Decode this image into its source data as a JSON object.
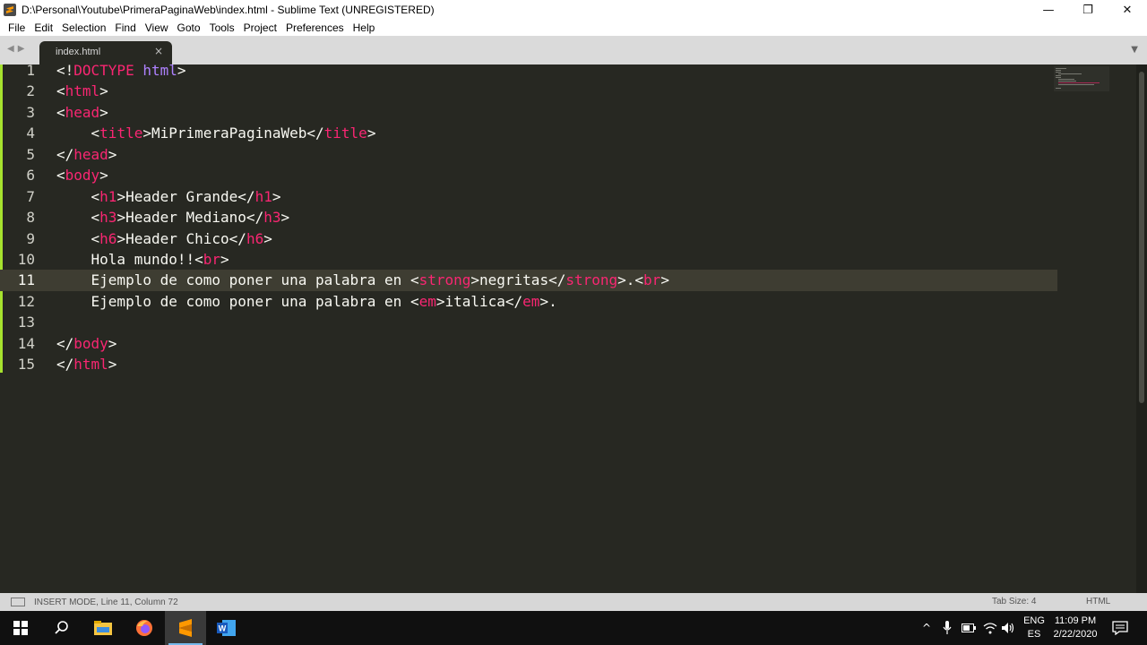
{
  "window": {
    "title": "D:\\Personal\\Youtube\\PrimeraPaginaWeb\\index.html - Sublime Text (UNREGISTERED)",
    "minimize_glyph": "—",
    "maximize_glyph": "❐",
    "close_glyph": "✕"
  },
  "menu": [
    {
      "label": "File"
    },
    {
      "label": "Edit"
    },
    {
      "label": "Selection"
    },
    {
      "label": "Find"
    },
    {
      "label": "View"
    },
    {
      "label": "Goto"
    },
    {
      "label": "Tools"
    },
    {
      "label": "Project"
    },
    {
      "label": "Preferences"
    },
    {
      "label": "Help"
    }
  ],
  "tabs": {
    "nav_glyph": "◀▶",
    "active_tab": {
      "label": "index.html",
      "close_glyph": "×"
    },
    "dropdown_glyph": "▼"
  },
  "editor": {
    "active_line": 11,
    "lines": [
      [
        {
          "c": "p",
          "v": "<!"
        },
        {
          "c": "t",
          "v": "DOCTYPE"
        },
        {
          "c": "p",
          "v": " "
        },
        {
          "c": "kw",
          "v": "html"
        },
        {
          "c": "p",
          "v": ">"
        }
      ],
      [
        {
          "c": "p",
          "v": "<"
        },
        {
          "c": "t",
          "v": "html"
        },
        {
          "c": "p",
          "v": ">"
        }
      ],
      [
        {
          "c": "p",
          "v": "<"
        },
        {
          "c": "t",
          "v": "head"
        },
        {
          "c": "p",
          "v": ">"
        }
      ],
      [
        {
          "c": "p",
          "v": "    <"
        },
        {
          "c": "t",
          "v": "title"
        },
        {
          "c": "p",
          "v": ">MiPrimeraPaginaWeb</"
        },
        {
          "c": "t",
          "v": "title"
        },
        {
          "c": "p",
          "v": ">"
        }
      ],
      [
        {
          "c": "p",
          "v": "</"
        },
        {
          "c": "t",
          "v": "head"
        },
        {
          "c": "p",
          "v": ">"
        }
      ],
      [
        {
          "c": "p",
          "v": "<"
        },
        {
          "c": "t",
          "v": "body"
        },
        {
          "c": "p",
          "v": ">"
        }
      ],
      [
        {
          "c": "p",
          "v": "    <"
        },
        {
          "c": "t",
          "v": "h1"
        },
        {
          "c": "p",
          "v": ">Header Grande</"
        },
        {
          "c": "t",
          "v": "h1"
        },
        {
          "c": "p",
          "v": ">"
        }
      ],
      [
        {
          "c": "p",
          "v": "    <"
        },
        {
          "c": "t",
          "v": "h3"
        },
        {
          "c": "p",
          "v": ">Header Mediano</"
        },
        {
          "c": "t",
          "v": "h3"
        },
        {
          "c": "p",
          "v": ">"
        }
      ],
      [
        {
          "c": "p",
          "v": "    <"
        },
        {
          "c": "t",
          "v": "h6"
        },
        {
          "c": "p",
          "v": ">Header Chico</"
        },
        {
          "c": "t",
          "v": "h6"
        },
        {
          "c": "p",
          "v": ">"
        }
      ],
      [
        {
          "c": "p",
          "v": "    Hola mundo!!<"
        },
        {
          "c": "t",
          "v": "br"
        },
        {
          "c": "p",
          "v": ">"
        }
      ],
      [
        {
          "c": "p",
          "v": "    Ejemplo de como poner una palabra en <"
        },
        {
          "c": "t",
          "v": "strong"
        },
        {
          "c": "p",
          "v": ">negritas</"
        },
        {
          "c": "t",
          "v": "strong"
        },
        {
          "c": "p",
          "v": ">.<"
        },
        {
          "c": "t",
          "v": "br"
        },
        {
          "c": "p",
          "v": ">"
        }
      ],
      [
        {
          "c": "p",
          "v": "    Ejemplo de como poner una palabra en <"
        },
        {
          "c": "t",
          "v": "em"
        },
        {
          "c": "p",
          "v": ">italica</"
        },
        {
          "c": "t",
          "v": "em"
        },
        {
          "c": "p",
          "v": ">."
        }
      ],
      [],
      [
        {
          "c": "p",
          "v": "</"
        },
        {
          "c": "t",
          "v": "body"
        },
        {
          "c": "p",
          "v": ">"
        }
      ],
      [
        {
          "c": "p",
          "v": "</"
        },
        {
          "c": "t",
          "v": "html"
        },
        {
          "c": "p",
          "v": ">"
        }
      ]
    ]
  },
  "status": {
    "mode": "INSERT MODE, Line 11, Column 72",
    "tab_size": "Tab Size: 4",
    "syntax": "HTML"
  },
  "taskbar": {
    "apps": [
      {
        "name": "search-icon"
      },
      {
        "name": "file-explorer-icon"
      },
      {
        "name": "firefox-icon"
      },
      {
        "name": "sublime-text-icon",
        "active": true
      },
      {
        "name": "word-icon"
      }
    ],
    "tray": {
      "chevron_glyph": "^",
      "lang_primary": "ENG",
      "lang_secondary": "ES",
      "time": "11:09 PM",
      "date": "2/22/2020"
    }
  },
  "colors": {
    "tag": "#f92672",
    "doctype_keyword": "#ae81ff",
    "editor_bg": "#272822",
    "modified_gutter": "#a6e22e"
  }
}
